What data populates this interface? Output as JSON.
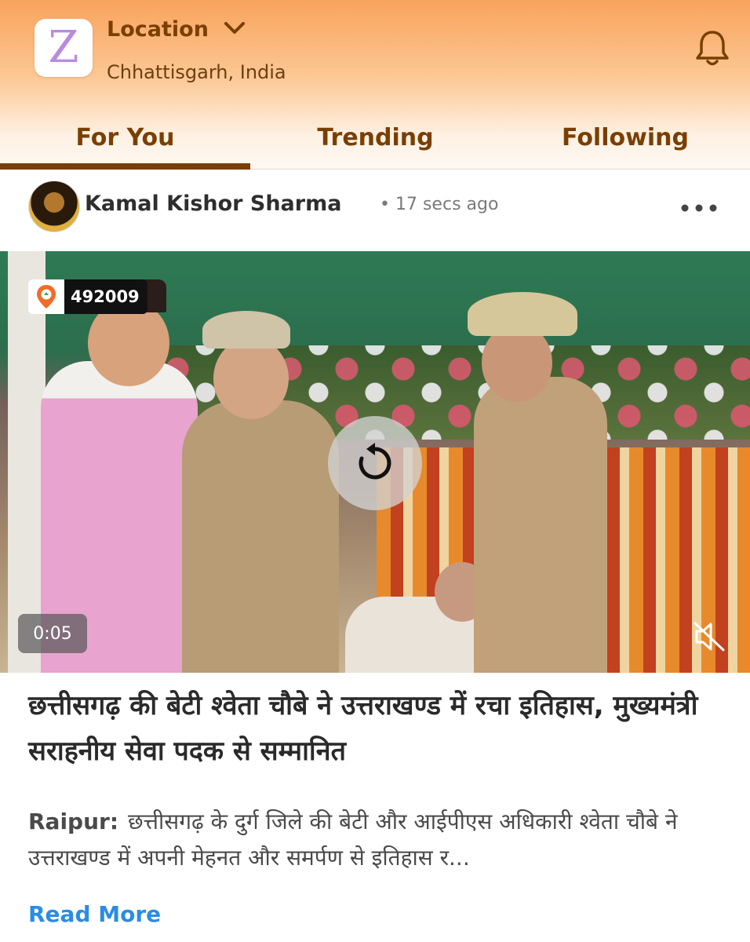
{
  "header": {
    "logo_letter": "Z",
    "location_label": "Location",
    "location_value": "Chhattisgarh, India",
    "icons": {
      "dropdown": "chevron-down-icon",
      "notifications": "bell-icon"
    }
  },
  "tabs": [
    {
      "label": "For You",
      "active": true
    },
    {
      "label": "Trending",
      "active": false
    },
    {
      "label": "Following",
      "active": false
    }
  ],
  "post": {
    "author": "Kamal Kishor Sharma",
    "time": "17 secs ago",
    "video": {
      "pincode": "492009",
      "duration": "0:05",
      "icons": {
        "replay": "replay-icon",
        "mute": "muted-speaker-icon",
        "pin": "location-pin-icon"
      }
    },
    "headline": "छत्तीसगढ़ की बेटी श्वेता चौबे ने उत्तराखण्ड में रचा इतिहास, मुख्यमंत्री सराहनीय सेवा पदक से सम्मानित",
    "place": "Raipur:",
    "summary": "छत्तीसगढ़ के दुर्ग जिले की बेटी और आईपीएस अधिकारी श्वेता चौबे ने उत्तराखण्ड में अपनी मेहनत और समर्पण से इतिहास र...",
    "read_more": "Read More"
  },
  "colors": {
    "brand_brown": "#7a3f00",
    "header_orange": "#f9a35c",
    "link_blue": "#2a8ce6"
  }
}
